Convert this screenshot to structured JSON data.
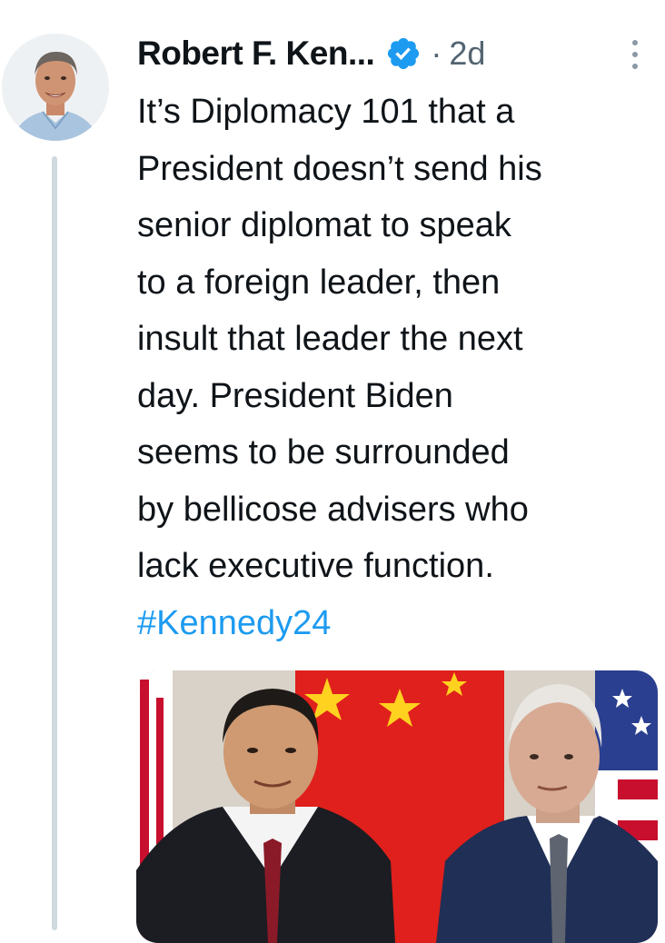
{
  "author": {
    "display_name": "Robert F. Ken...",
    "verified": true,
    "separator": "·",
    "timestamp": "2d"
  },
  "tweet": {
    "lines": [
      "It’s Diplomacy 101 that a",
      "President doesn’t send his",
      "senior diplomat to speak",
      "to a foreign leader, then",
      "insult that leader the next",
      "day. President Biden",
      "seems to be surrounded",
      "by bellicose advisers who",
      "lack executive function."
    ],
    "hashtag": "#Kennedy24"
  },
  "colors": {
    "link": "#1d9bf0",
    "verified_badge": "#1d9bf0",
    "muted_text": "#536471",
    "thread_line": "#cfd9de"
  },
  "icons": {
    "verified": "verified-badge-icon",
    "more": "more-dots-icon"
  }
}
